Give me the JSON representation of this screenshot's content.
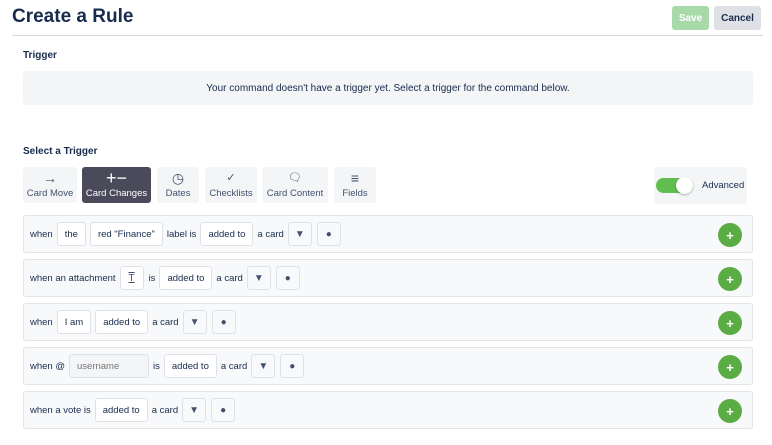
{
  "header": {
    "title": "Create a Rule",
    "save": "Save",
    "cancel": "Cancel"
  },
  "trigger": {
    "heading": "Trigger",
    "notice": "Your command doesn't have a trigger yet. Select a trigger for the command below."
  },
  "select": {
    "heading": "Select a Trigger",
    "tabs": [
      {
        "label": "Card Move",
        "icon": "→"
      },
      {
        "label": "Card Changes",
        "icon": "+−"
      },
      {
        "label": "Dates",
        "icon": "◷"
      },
      {
        "label": "Checklists",
        "icon": "✓"
      },
      {
        "label": "Card Content",
        "icon": "🗨"
      },
      {
        "label": "Fields",
        "icon": "≡"
      }
    ],
    "advanced": "Advanced"
  },
  "rows": [
    {
      "parts": [
        "when",
        "the",
        "red \"Finance\"",
        "label is",
        "added to",
        "a card"
      ]
    },
    {
      "parts": [
        "when an attachment",
        "is",
        "added to",
        "a card"
      ],
      "icon": "T"
    },
    {
      "parts": [
        "when",
        "I am",
        "added to",
        "a card"
      ]
    },
    {
      "parts": [
        "when @",
        "is",
        "added to",
        "a card"
      ],
      "placeholder": "username"
    },
    {
      "parts": [
        "when a vote is",
        "added to",
        "a card"
      ]
    }
  ],
  "icons": {
    "filter": "▼",
    "person": "●",
    "plus": "+"
  },
  "colors": {
    "accent": "#5aac44",
    "active_tab": "#4a4a5a"
  }
}
